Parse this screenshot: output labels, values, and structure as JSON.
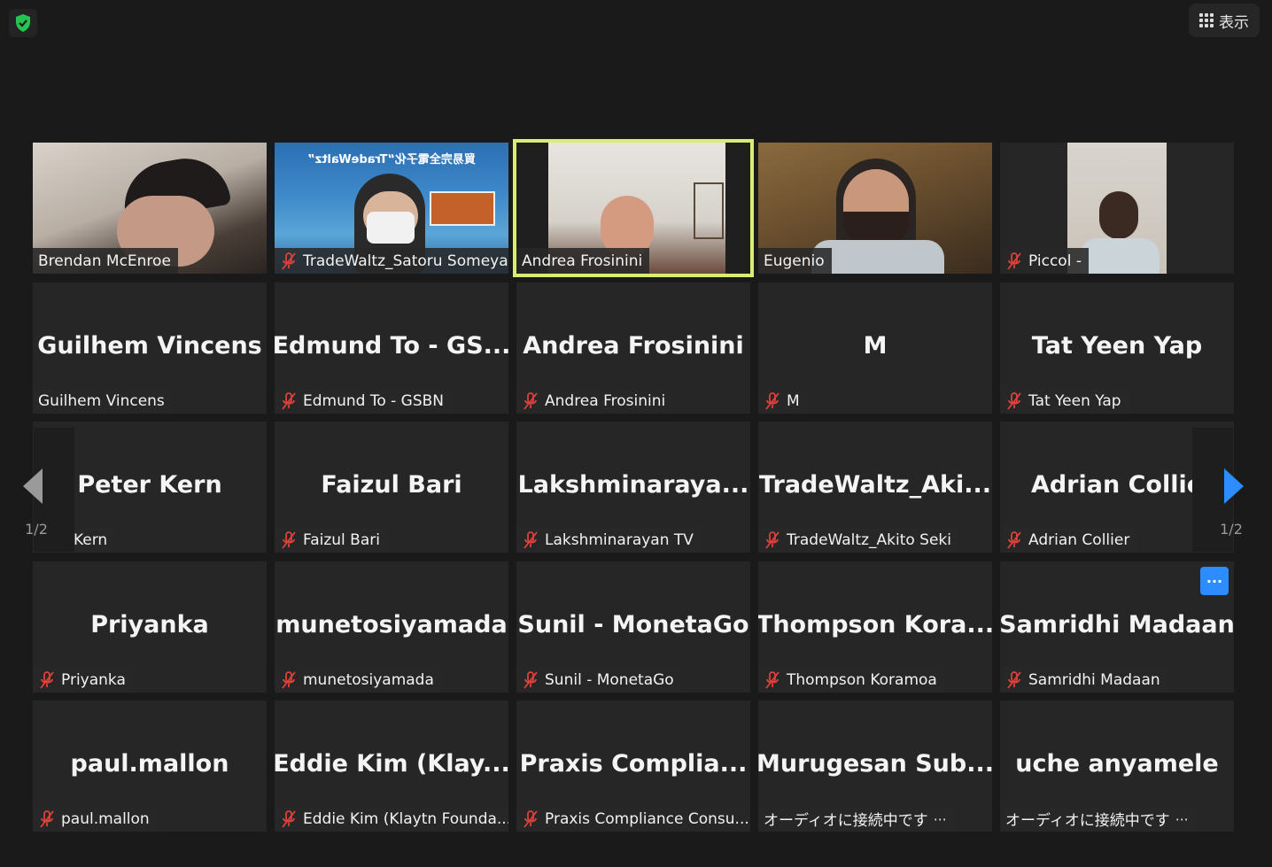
{
  "topbar": {
    "view_label": "表示"
  },
  "nav": {
    "page_left": "1/2",
    "page_right": "1/2"
  },
  "connecting_dots": "⋯",
  "more_label": "···",
  "video_banner": "貿易完全電子化“TradeWaltz”",
  "tiles": [
    {
      "big": "",
      "label": "Brendan McEnroe",
      "muted": false,
      "video": true
    },
    {
      "big": "",
      "label": "TradeWaltz_Satoru Someya",
      "muted": true,
      "video": true
    },
    {
      "big": "",
      "label": "Andrea Frosinini",
      "muted": false,
      "video": true,
      "active": true
    },
    {
      "big": "",
      "label": "Eugenio",
      "muted": false,
      "video": true
    },
    {
      "big": "",
      "label": "Piccol -",
      "muted": true,
      "video": true
    },
    {
      "big": "Guilhem Vincens",
      "label": "Guilhem Vincens",
      "muted": false
    },
    {
      "big": "Edmund To - GS...",
      "label": "Edmund To - GSBN",
      "muted": true
    },
    {
      "big": "Andrea Frosinini",
      "label": "Andrea Frosinini",
      "muted": true
    },
    {
      "big": "M",
      "label": "M",
      "muted": true
    },
    {
      "big": "Tat Yeen Yap",
      "label": "Tat Yeen Yap",
      "muted": true
    },
    {
      "big": "Peter Kern",
      "label": "eter Kern",
      "muted": false
    },
    {
      "big": "Faizul Bari",
      "label": "Faizul Bari",
      "muted": true
    },
    {
      "big": "Lakshminaraya...",
      "label": "Lakshminarayan TV",
      "muted": true
    },
    {
      "big": "TradeWaltz_Aki...",
      "label": "TradeWaltz_Akito Seki",
      "muted": true
    },
    {
      "big": "Adrian Collie",
      "label": "Adrian Collier",
      "muted": true
    },
    {
      "big": "Priyanka",
      "label": "Priyanka",
      "muted": true
    },
    {
      "big": "munetosiyamada",
      "label": "munetosiyamada",
      "muted": true
    },
    {
      "big": "Sunil - MonetaGo",
      "label": "Sunil - MonetaGo",
      "muted": true
    },
    {
      "big": "Thompson Kora...",
      "label": "Thompson Koramoa",
      "muted": true
    },
    {
      "big": "Samridhi Madaan",
      "label": "Samridhi Madaan",
      "muted": true,
      "more": true
    },
    {
      "big": "paul.mallon",
      "label": "paul.mallon",
      "muted": true
    },
    {
      "big": "Eddie Kim (Klay...",
      "label": "Eddie Kim (Klaytn Founda...",
      "muted": true
    },
    {
      "big": "Praxis Complia...",
      "label": "Praxis Compliance Consu...",
      "muted": true
    },
    {
      "big": "Murugesan Sub...",
      "label": "オーディオに接続中です",
      "muted": false,
      "connecting": true
    },
    {
      "big": "uche anyamele",
      "label": "オーディオに接続中です",
      "muted": false,
      "connecting": true
    }
  ],
  "colors": {
    "accent_active": "#d8ee6e",
    "mute_red": "#e0403a",
    "nav_blue": "#2d8cff",
    "shield_green": "#23c552"
  }
}
